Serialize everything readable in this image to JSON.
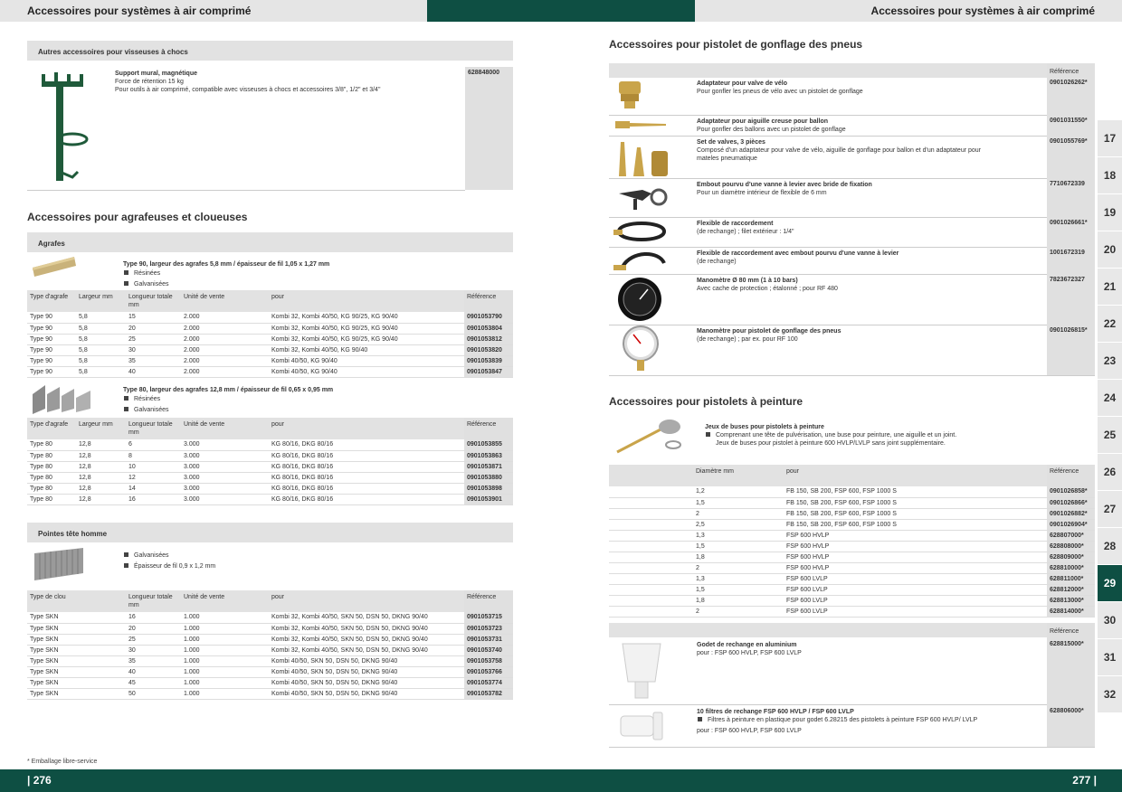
{
  "header": {
    "left_title": "Accessoires pour systèmes à air comprimé",
    "right_title": "Accessoires pour systèmes à air comprimé"
  },
  "left": {
    "visseuses": {
      "bar": "Autres accessoires pour visseuses à chocs",
      "product": {
        "title": "Support mural, magnétique",
        "line1": "Force de rétention 15 kg",
        "line2": "Pour outils à air comprimé, compatible avec visseuses à chocs et accessoires 3/8\", 1/2\" et 3/4\"",
        "ref": "628848000"
      }
    },
    "agrafeuses": {
      "heading": "Accessoires pour agrafeuses et cloueuses",
      "bar": "Agrafes",
      "type90": {
        "title": "Type 90, largeur des agrafes 5,8 mm / épaisseur de fil 1,05 x 1,27 mm",
        "bullets": [
          "Résinées",
          "Galvanisées"
        ]
      },
      "type80": {
        "title": "Type 80, largeur des agrafes 12,8 mm / épaisseur de fil 0,65 x 0,95 mm",
        "bullets": [
          "Résinées",
          "Galvanisées"
        ]
      },
      "columns": [
        "Type d'agrafe",
        "Largeur mm",
        "Longueur totale mm",
        "Unité de vente",
        "pour",
        "Référence"
      ],
      "rows90": [
        [
          "Type 90",
          "5,8",
          "15",
          "2.000",
          "Kombi 32, Kombi 40/50, KG 90/25, KG 90/40",
          "0901053790"
        ],
        [
          "Type 90",
          "5,8",
          "20",
          "2.000",
          "Kombi 32, Kombi 40/50, KG 90/25, KG 90/40",
          "0901053804"
        ],
        [
          "Type 90",
          "5,8",
          "25",
          "2.000",
          "Kombi 32, Kombi 40/50, KG 90/25, KG 90/40",
          "0901053812"
        ],
        [
          "Type 90",
          "5,8",
          "30",
          "2.000",
          "Kombi 32, Kombi 40/50, KG 90/40",
          "0901053820"
        ],
        [
          "Type 90",
          "5,8",
          "35",
          "2.000",
          "Kombi 40/50, KG 90/40",
          "0901053839"
        ],
        [
          "Type 90",
          "5,8",
          "40",
          "2.000",
          "Kombi 40/50, KG 90/40",
          "0901053847"
        ]
      ],
      "rows80": [
        [
          "Type 80",
          "12,8",
          "6",
          "3.000",
          "KG 80/16, DKG 80/16",
          "0901053855"
        ],
        [
          "Type 80",
          "12,8",
          "8",
          "3.000",
          "KG 80/16, DKG 80/16",
          "0901053863"
        ],
        [
          "Type 80",
          "12,8",
          "10",
          "3.000",
          "KG 80/16, DKG 80/16",
          "0901053871"
        ],
        [
          "Type 80",
          "12,8",
          "12",
          "3.000",
          "KG 80/16, DKG 80/16",
          "0901053880"
        ],
        [
          "Type 80",
          "12,8",
          "14",
          "3.000",
          "KG 80/16, DKG 80/16",
          "0901053898"
        ],
        [
          "Type 80",
          "12,8",
          "16",
          "3.000",
          "KG 80/16, DKG 80/16",
          "0901053901"
        ]
      ]
    },
    "pointes": {
      "bar": "Pointes tête homme",
      "bullets": [
        "Galvanisées",
        "Épaisseur de fil 0,9 x 1,2 mm"
      ],
      "columns": [
        "Type de clou",
        "Longueur totale mm",
        "Unité de vente",
        "pour",
        "Référence"
      ],
      "rows": [
        [
          "Type SKN",
          "16",
          "1.000",
          "Kombi 32, Kombi 40/50, SKN 50, DSN 50, DKNG 90/40",
          "0901053715"
        ],
        [
          "Type SKN",
          "20",
          "1.000",
          "Kombi 32, Kombi 40/50, SKN 50, DSN 50, DKNG 90/40",
          "0901053723"
        ],
        [
          "Type SKN",
          "25",
          "1.000",
          "Kombi 32, Kombi 40/50, SKN 50, DSN 50, DKNG 90/40",
          "0901053731"
        ],
        [
          "Type SKN",
          "30",
          "1.000",
          "Kombi 32, Kombi 40/50, SKN 50, DSN 50, DKNG 90/40",
          "0901053740"
        ],
        [
          "Type SKN",
          "35",
          "1.000",
          "Kombi 40/50, SKN 50, DSN 50, DKNG 90/40",
          "0901053758"
        ],
        [
          "Type SKN",
          "40",
          "1.000",
          "Kombi 40/50, SKN 50, DSN 50, DKNG 90/40",
          "0901053766"
        ],
        [
          "Type SKN",
          "45",
          "1.000",
          "Kombi 40/50, SKN 50, DSN 50, DKNG 90/40",
          "0901053774"
        ],
        [
          "Type SKN",
          "50",
          "1.000",
          "Kombi 40/50, SKN 50, DSN 50, DKNG 90/40",
          "0901053782"
        ]
      ]
    },
    "footnote": "* Emballage libre-service",
    "page_number": "| 276"
  },
  "right": {
    "gonflage": {
      "heading": "Accessoires pour pistolet de gonflage des pneus",
      "ref_header": "Référence",
      "items": [
        {
          "title": "Adaptateur pour valve de vélo",
          "desc": "Pour gonfler les pneus de vélo avec un pistolet de gonflage",
          "ref": "0901026262*"
        },
        {
          "title": "Adaptateur pour aiguille creuse pour ballon",
          "desc": "Pour gonfler des ballons avec un pistolet de gonflage",
          "ref": "0901031550*"
        },
        {
          "title": "Set de valves, 3 pièces",
          "desc": "Composé d'un adaptateur pour valve de vélo, aiguille de gonflage pour ballon et d'un adaptateur pour mateles pneumatique",
          "ref": "0901055769*"
        },
        {
          "title": "Embout pourvu d'une vanne à levier avec bride de fixation",
          "desc": "Pour un diamètre intérieur de flexible de 6 mm",
          "ref": "7710672339"
        },
        {
          "title": "Flexible de raccordement",
          "desc": "(de rechange) ; filet extérieur : 1/4\"",
          "ref": "0901026661*"
        },
        {
          "title": "Flexible de raccordement avec embout pourvu d'une vanne à levier",
          "desc": "(de rechange)",
          "ref": "1001672319"
        },
        {
          "title": "Manomètre Ø 80 mm (1 à 10 bars)",
          "desc": "Avec cache de protection ; étalonné ; pour RF 480",
          "ref": "7823672327"
        },
        {
          "title": "Manomètre pour pistolet de gonflage des pneus",
          "desc": "(de rechange) ; par ex. pour RF 100",
          "ref": "0901026815*"
        }
      ]
    },
    "peinture": {
      "heading": "Accessoires pour pistolets à peinture",
      "buses_title": "Jeux de buses pour pistolets à peinture",
      "buses_bullet": "Comprenant une tête de pulvérisation, une buse pour peinture, une aiguille et un joint.",
      "buses_line2": "Jeux de buses pour pistolet à peinture 600 HVLP/LVLP sans joint supplémentaire.",
      "columns": [
        "Diamètre mm",
        "pour",
        "Référence"
      ],
      "rows": [
        [
          "1,2",
          "FB 150, SB 200, FSP 600, FSP 1000 S",
          "0901026858*"
        ],
        [
          "1,5",
          "FB 150, SB 200, FSP 600, FSP 1000 S",
          "0901026866*"
        ],
        [
          "2",
          "FB 150, SB 200, FSP 600, FSP 1000 S",
          "0901026882*"
        ],
        [
          "2,5",
          "FB 150, SB 200, FSP 600, FSP 1000 S",
          "0901026904*"
        ],
        [
          "1,3",
          "FSP 600 HVLP",
          "628807000*"
        ],
        [
          "1,5",
          "FSP 600 HVLP",
          "628808000*"
        ],
        [
          "1,8",
          "FSP 600 HVLP",
          "628809000*"
        ],
        [
          "2",
          "FSP 600 HVLP",
          "628810000*"
        ],
        [
          "1,3",
          "FSP 600 LVLP",
          "628811000*"
        ],
        [
          "1,5",
          "FSP 600 LVLP",
          "628812000*"
        ],
        [
          "1,8",
          "FSP 600 LVLP",
          "628813000*"
        ],
        [
          "2",
          "FSP 600 LVLP",
          "628814000*"
        ]
      ],
      "ref_header": "Référence",
      "godet": {
        "title": "Godet de rechange en aluminium",
        "desc": "pour : FSP 600 HVLP, FSP 600 LVLP",
        "ref": "628815000*"
      },
      "filtres": {
        "title": "10 filtres de rechange FSP 600 HVLP / FSP 600 LVLP",
        "bullet": "Filtres à peinture en plastique pour godet 6.28215 des pistolets à peinture FSP 600 HVLP/ LVLP",
        "desc": "pour : FSP 600 HVLP, FSP 600 LVLP",
        "ref": "628806000*"
      }
    },
    "page_number": "277 |"
  },
  "tabs": [
    "17",
    "18",
    "19",
    "20",
    "21",
    "22",
    "23",
    "24",
    "25",
    "26",
    "27",
    "28",
    "29",
    "30",
    "31",
    "32"
  ],
  "active_tab": "29",
  "colors": {
    "brand_green": "#0e4f43",
    "bar_grey": "#e2e2e2"
  }
}
